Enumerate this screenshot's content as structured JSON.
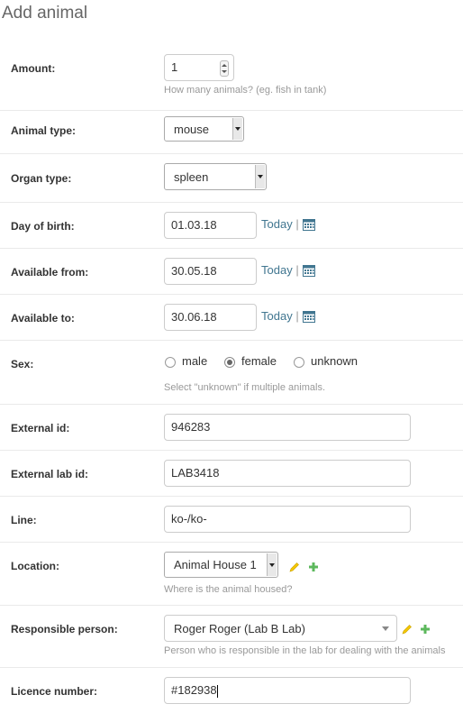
{
  "page": {
    "title": "Add animal"
  },
  "fields": {
    "amount": {
      "label": "Amount:",
      "value": "1",
      "help": "How many animals? (eg. fish in tank)"
    },
    "animal_type": {
      "label": "Animal type:",
      "value": "mouse"
    },
    "organ_type": {
      "label": "Organ type:",
      "value": "spleen"
    },
    "day_of_birth": {
      "label": "Day of birth:",
      "value": "01.03.18",
      "today": "Today",
      "sep": "|"
    },
    "available_from": {
      "label": "Available from:",
      "value": "30.05.18",
      "today": "Today",
      "sep": "|"
    },
    "available_to": {
      "label": "Available to:",
      "value": "30.06.18",
      "today": "Today",
      "sep": "|"
    },
    "sex": {
      "label": "Sex:",
      "options": [
        "male",
        "female",
        "unknown"
      ],
      "selected": "female",
      "help": "Select \"unknown\" if multiple animals."
    },
    "external_id": {
      "label": "External id:",
      "value": "946283"
    },
    "external_lab_id": {
      "label": "External lab id:",
      "value": "LAB3418"
    },
    "line": {
      "label": "Line:",
      "value": "ko-/ko-"
    },
    "location": {
      "label": "Location:",
      "value": "Animal House 1",
      "help": "Where is the animal housed?"
    },
    "responsible_person": {
      "label": "Responsible person:",
      "value": "Roger Roger (Lab B Lab)",
      "help": "Person who is responsible in the lab for dealing with the animals"
    },
    "licence_number": {
      "label": "Licence number:",
      "value": "#182938"
    }
  },
  "colors": {
    "link": "#417690",
    "pencil": "#f5c700",
    "plus": "#5cb85c",
    "calendar": "#417690"
  },
  "icons": [
    "calendar-icon",
    "pencil-icon",
    "plus-icon"
  ]
}
